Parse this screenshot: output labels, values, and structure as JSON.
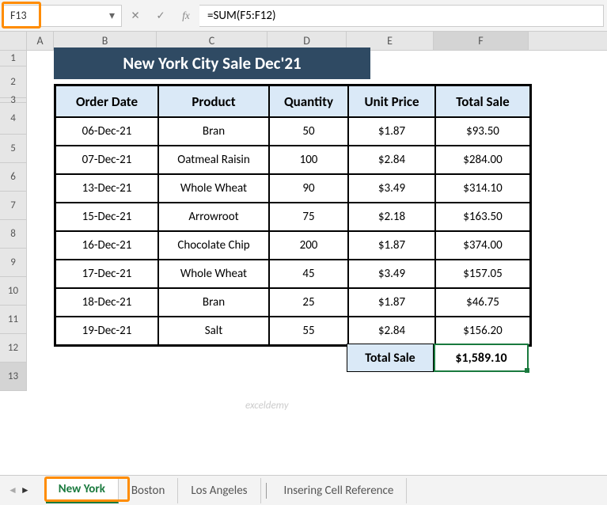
{
  "name_box": "F13",
  "formula": "=SUM(F5:F12)",
  "columns": [
    "A",
    "B",
    "C",
    "D",
    "E",
    "F"
  ],
  "rows": [
    "1",
    "2",
    "3",
    "4",
    "5",
    "6",
    "7",
    "8",
    "9",
    "10",
    "11",
    "12",
    "13"
  ],
  "title": "New York City Sale Dec'21",
  "headers": {
    "b": "Order Date",
    "c": "Product",
    "d": "Quantity",
    "e": "Unit Price",
    "f": "Total Sale"
  },
  "data": [
    {
      "b": "06-Dec-21",
      "c": "Bran",
      "d": "50",
      "e": "$1.87",
      "f": "$93.50"
    },
    {
      "b": "07-Dec-21",
      "c": "Oatmeal Raisin",
      "d": "100",
      "e": "$2.84",
      "f": "$284.00"
    },
    {
      "b": "13-Dec-21",
      "c": "Whole Wheat",
      "d": "90",
      "e": "$3.49",
      "f": "$314.10"
    },
    {
      "b": "15-Dec-21",
      "c": "Arrowroot",
      "d": "75",
      "e": "$2.18",
      "f": "$163.50"
    },
    {
      "b": "16-Dec-21",
      "c": "Chocolate Chip",
      "d": "200",
      "e": "$1.87",
      "f": "$374.00"
    },
    {
      "b": "17-Dec-21",
      "c": "Whole Wheat",
      "d": "45",
      "e": "$3.49",
      "f": "$157.05"
    },
    {
      "b": "18-Dec-21",
      "c": "Bran",
      "d": "25",
      "e": "$1.87",
      "f": "$46.75"
    },
    {
      "b": "19-Dec-21",
      "c": "Salt",
      "d": "55",
      "e": "$2.84",
      "f": "$156.20"
    }
  ],
  "total_label": "Total Sale",
  "total_value": "$1,589.10",
  "tabs": {
    "t0": "New York",
    "t1": "Boston",
    "t2": "Los Angeles",
    "t3": "Insering Cell Reference"
  },
  "watermark": "exceldemy"
}
